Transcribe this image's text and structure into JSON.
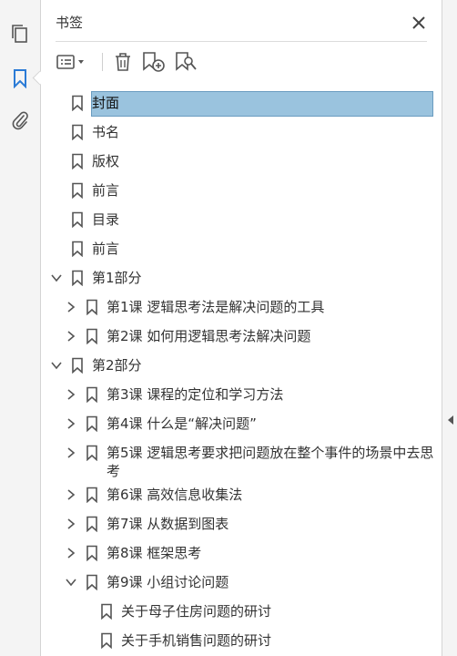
{
  "panel": {
    "title": "书签"
  },
  "colors": {
    "accent": "#2b7bd6",
    "selection": "#9ac3de",
    "icon": "#555555"
  },
  "rail": {
    "icons": [
      "pages-icon",
      "bookmark-icon",
      "attachment-icon"
    ]
  },
  "toolbar": {
    "icons": [
      "options-menu-icon",
      "delete-icon",
      "new-bookmark-icon",
      "find-bookmark-icon"
    ]
  },
  "bookmarks": [
    {
      "label": "封面",
      "level": 0,
      "state": "leaf",
      "selected": true
    },
    {
      "label": "书名",
      "level": 0,
      "state": "leaf"
    },
    {
      "label": "版权",
      "level": 0,
      "state": "leaf"
    },
    {
      "label": "前言",
      "level": 0,
      "state": "leaf"
    },
    {
      "label": "目录",
      "level": 0,
      "state": "leaf"
    },
    {
      "label": "前言",
      "level": 0,
      "state": "leaf"
    },
    {
      "label": "第1部分",
      "level": 0,
      "state": "expanded"
    },
    {
      "label": "第1课  逻辑思考法是解决问题的工具",
      "level": 1,
      "state": "collapsed"
    },
    {
      "label": "第2课  如何用逻辑思考法解决问题",
      "level": 1,
      "state": "collapsed"
    },
    {
      "label": "第2部分",
      "level": 0,
      "state": "expanded"
    },
    {
      "label": "第3课  课程的定位和学习方法",
      "level": 1,
      "state": "collapsed"
    },
    {
      "label": "第4课  什么是“解决问题”",
      "level": 1,
      "state": "collapsed"
    },
    {
      "label": "第5课  逻辑思考要求把问题放在整个事件的场景中去思考",
      "level": 1,
      "state": "collapsed",
      "wrap": true
    },
    {
      "label": "第6课  高效信息收集法",
      "level": 1,
      "state": "collapsed"
    },
    {
      "label": "第7课  从数据到图表",
      "level": 1,
      "state": "collapsed"
    },
    {
      "label": "第8课  框架思考",
      "level": 1,
      "state": "collapsed"
    },
    {
      "label": "第9课  小组讨论问题",
      "level": 1,
      "state": "expanded"
    },
    {
      "label": "关于母子住房问题的研讨",
      "level": 2,
      "state": "leaf"
    },
    {
      "label": "关于手机销售问题的研讨",
      "level": 2,
      "state": "leaf"
    }
  ]
}
